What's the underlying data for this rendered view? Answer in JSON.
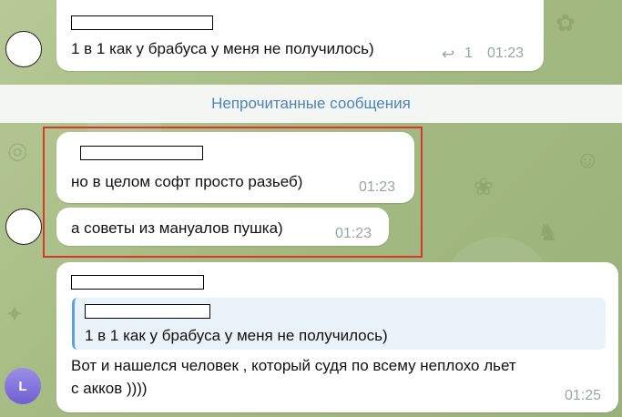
{
  "messages": [
    {
      "text": "1 в 1 как у брабуса у меня не получилось)",
      "reply_count": "1",
      "time": "01:23"
    },
    {
      "text": "но в целом софт просто разьеб)",
      "time": "01:23"
    },
    {
      "text": "а советы из мануалов пушка)",
      "time": "01:23"
    },
    {
      "quote_text": "1 в 1 как у брабуса у меня не получилось)",
      "text_line1": "Вот и нашелся человек , который судя по всему неплохо льет",
      "text_line2": "с акков ))))",
      "time": "01:25"
    }
  ],
  "unread_label": "Непрочитанные сообщения",
  "avatar_initial": "L",
  "colors": {
    "highlight": "#d9372d",
    "accent": "#4a86b8",
    "avatar": "#7f6fdc"
  }
}
